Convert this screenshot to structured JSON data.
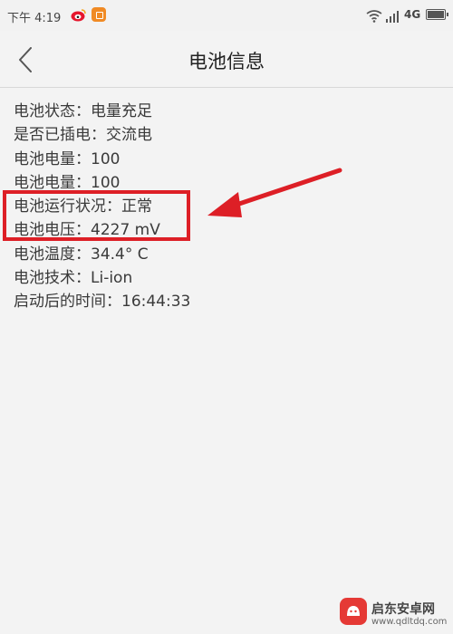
{
  "status_bar": {
    "time": "下午 4:19",
    "network": "4G",
    "icons": [
      "weibo-icon",
      "notification-icon",
      "wifi-icon",
      "signal-icon",
      "battery-icon"
    ]
  },
  "header": {
    "title": "电池信息",
    "back_icon": "chevron-left-icon"
  },
  "battery_info": [
    {
      "label": "电池状态",
      "value": "电量充足"
    },
    {
      "label": "是否已插电",
      "value": "交流电"
    },
    {
      "label": "电池电量",
      "value": "100"
    },
    {
      "label": "电池电量",
      "value": "100"
    },
    {
      "label": "电池运行状况",
      "value": "正常"
    },
    {
      "label": "电池电压",
      "value": "4227 mV"
    },
    {
      "label": "电池温度",
      "value": "34.4° C"
    },
    {
      "label": "电池技术",
      "value": "Li-ion"
    },
    {
      "label": "启动后的时间",
      "value": "16:44:33"
    }
  ],
  "separator": "：",
  "annotation": {
    "color": "#dd1f26"
  },
  "watermark": {
    "name": "启东安卓网",
    "url": "www.qdltdq.com"
  }
}
